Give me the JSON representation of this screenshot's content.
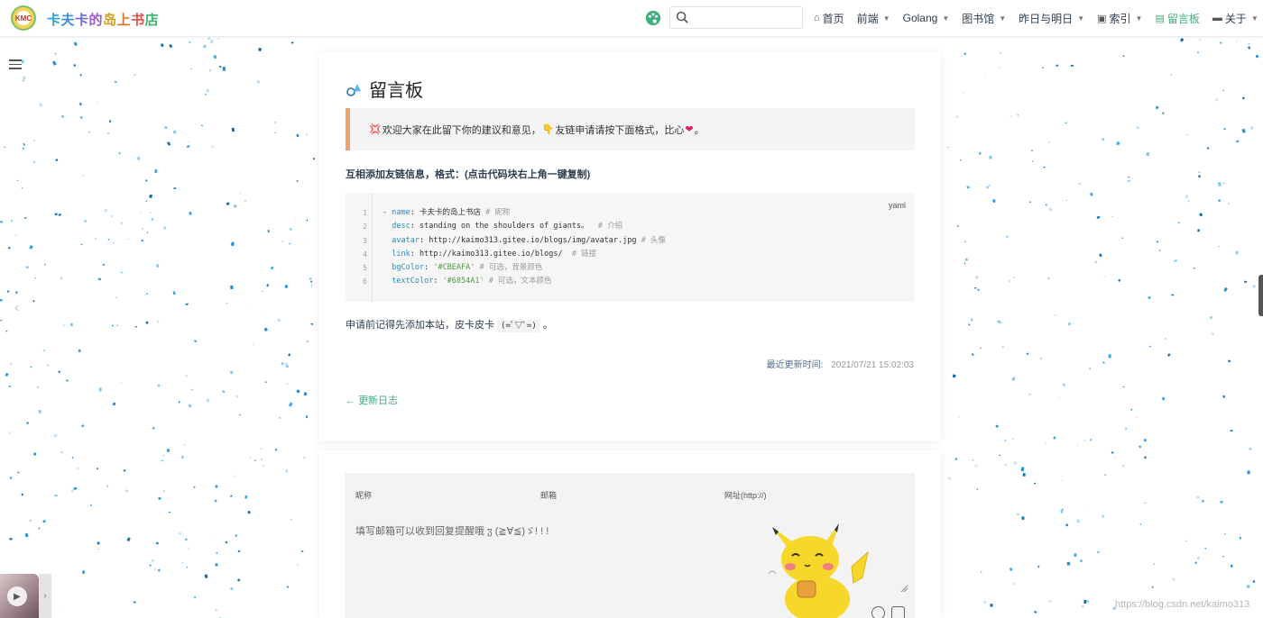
{
  "navbar": {
    "logo_text": "KMC",
    "site_title": [
      "卡",
      "夫",
      "卡",
      "的",
      "岛",
      "上",
      "书",
      "店"
    ],
    "search_placeholder": "",
    "items": [
      {
        "icon": "home-icon",
        "label": "首页",
        "has_caret": false
      },
      {
        "icon": "",
        "label": "前端",
        "has_caret": true
      },
      {
        "icon": "",
        "label": "Golang",
        "has_caret": true
      },
      {
        "icon": "",
        "label": "图书馆",
        "has_caret": true
      },
      {
        "icon": "",
        "label": "昨日与明日",
        "has_caret": true
      },
      {
        "icon": "index-icon",
        "label": "索引",
        "has_caret": true
      },
      {
        "icon": "message-board-icon",
        "label": "留言板",
        "has_caret": false,
        "active": true
      },
      {
        "icon": "about-icon",
        "label": "关于",
        "has_caret": true
      }
    ]
  },
  "page": {
    "title": "留言板",
    "tip": {
      "emoji_1": "💢",
      "text_1": "欢迎大家在此留下你的建议和意见，",
      "emoji_2": "👇",
      "text_2": "友链申请请按下面格式，比心",
      "emoji_3": "❤",
      "text_3": "。"
    },
    "subheading": "互相添加友链信息，格式：(点击代码块右上角一键复制)",
    "code": {
      "lang": "yaml",
      "line_numbers": [
        "1",
        "2",
        "3",
        "4",
        "5",
        "6"
      ],
      "lines": [
        {
          "prefix": "- ",
          "key": "name",
          "value": "卡夫卡的岛上书店",
          "comment": "# 昵称",
          "string": false
        },
        {
          "prefix": "  ",
          "key": "desc",
          "value": "standing on the shoulders of giants。",
          "comment": " # 介绍",
          "string": false
        },
        {
          "prefix": "  ",
          "key": "avatar",
          "value": "http://kaimo313.gitee.io/blogs/img/avatar.jpg",
          "comment": "# 头像",
          "string": false
        },
        {
          "prefix": "  ",
          "key": "link",
          "value": "http://kaimo313.gitee.io/blogs/",
          "comment": " # 链接",
          "string": false
        },
        {
          "prefix": "  ",
          "key": "bgColor",
          "value": "'#CBEAFA'",
          "comment": "# 可选，背景颜色",
          "string": true
        },
        {
          "prefix": "  ",
          "key": "textColor",
          "value": "'#6854A1'",
          "comment": "# 可选，文本颜色",
          "string": true
        }
      ]
    },
    "note_text": "申请前记得先添加本站，皮卡皮卡",
    "note_code": "(=ﾟ▽ﾟ=)",
    "note_end": "。",
    "last_updated_label": "最近更新时间:",
    "last_updated_value": "2021/07/21 15:02:03",
    "prev_arrow": "←",
    "prev_link": "更新日志"
  },
  "comment": {
    "nickname_placeholder": "昵称",
    "email_placeholder": "邮箱",
    "url_placeholder": "网址(http://)",
    "textarea_placeholder": "填写邮箱可以收到回复提醒哦 ჳ (≧∀≦)ゞ! ! !"
  },
  "player": {
    "toggle": "›"
  },
  "watermark": "https://blog.csdn.net/kaimo313",
  "colors": {
    "accent": "#3eaf7c",
    "tip_border": "#f0a36a",
    "heart": "#e0245e"
  }
}
